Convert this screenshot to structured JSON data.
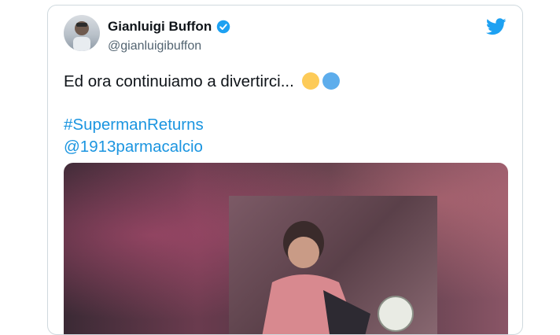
{
  "tweet": {
    "display_name": "Gianluigi Buffon",
    "handle": "@gianluigibuffon",
    "text": "Ed ora continuiamo a divertirci...",
    "hashtag": "#SupermanReturns",
    "mention": "@1913parmacalcio"
  },
  "colors": {
    "link": "#1b95e0",
    "verified": "#1da1f2",
    "emoji_yellow": "#fdcb58",
    "emoji_blue": "#5dadec"
  },
  "icons": [
    "twitter-bird-icon",
    "verified-badge-icon",
    "yellow-circle-emoji",
    "blue-circle-emoji"
  ]
}
